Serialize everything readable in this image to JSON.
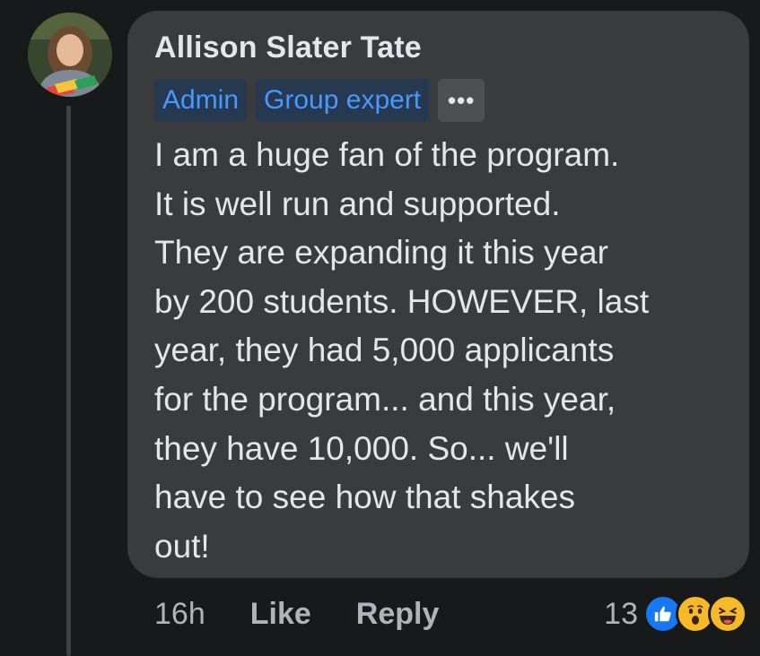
{
  "comment": {
    "author": "Allison Slater Tate",
    "badges": [
      "Admin",
      "Group expert"
    ],
    "more_label": "•••",
    "text_lines": [
      "I am a huge fan of the program.",
      "It is well run and supported.",
      "They are expanding it this year",
      "by 200 students. HOWEVER, last",
      "year, they had 5,000 applicants",
      "for the program... and this year,",
      "they have 10,000. So... we'll",
      "have to see how that shakes",
      "out!"
    ]
  },
  "actions": {
    "time": "16h",
    "like": "Like",
    "reply": "Reply"
  },
  "reactions": {
    "count": "13",
    "icons": [
      "like-reaction-icon",
      "wow-reaction-icon",
      "haha-reaction-icon"
    ],
    "colors": {
      "like": "#1877f2",
      "emoji": "#f7b928"
    }
  },
  "colors": {
    "background": "#18191a",
    "bubble": "#3a3b3c",
    "badge_bg": "#263951",
    "badge_text": "#4599ff",
    "secondary_text": "#b0b3b8"
  }
}
